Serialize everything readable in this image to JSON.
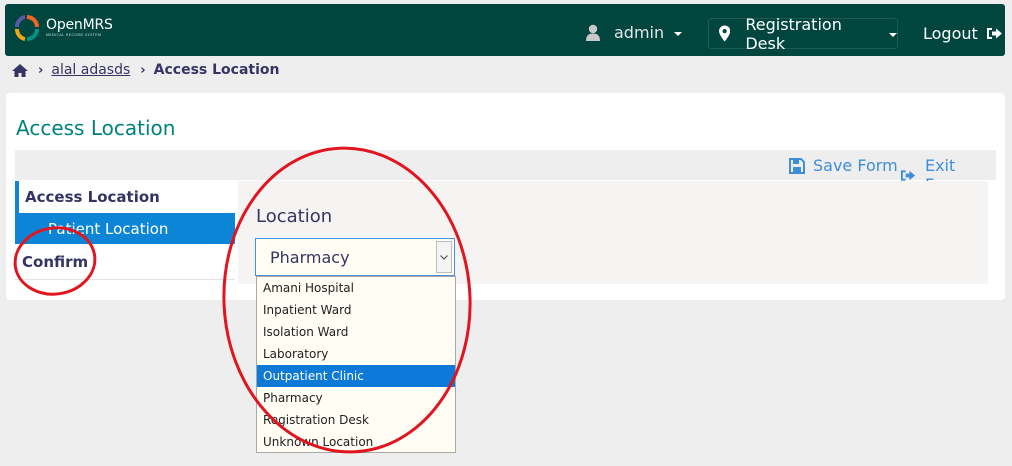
{
  "header": {
    "app_name": "OpenMRS",
    "app_tagline": "MEDICAL RECORD SYSTEM",
    "user": "admin",
    "location": "Registration Desk",
    "logout": "Logout"
  },
  "breadcrumb": {
    "patient": "alal adasds",
    "current": "Access Location"
  },
  "form": {
    "title": "Access Location",
    "save_label": "Save Form",
    "exit_label": "Exit Form"
  },
  "sidebar": {
    "section": "Access Location",
    "item": "Patient Location",
    "confirm": "Confirm"
  },
  "field": {
    "label": "Location",
    "selected": "Pharmacy",
    "options": [
      "Amani Hospital",
      "Inpatient Ward",
      "Isolation Ward",
      "Laboratory",
      "Outpatient Clinic",
      "Pharmacy",
      "Registration Desk",
      "Unknown Location"
    ],
    "highlighted_option": "Outpatient Clinic"
  },
  "colors": {
    "header_bg": "#00463f",
    "accent_blue": "#0d85d6",
    "title_teal": "#00827e",
    "annotation_red": "#e0151f"
  }
}
